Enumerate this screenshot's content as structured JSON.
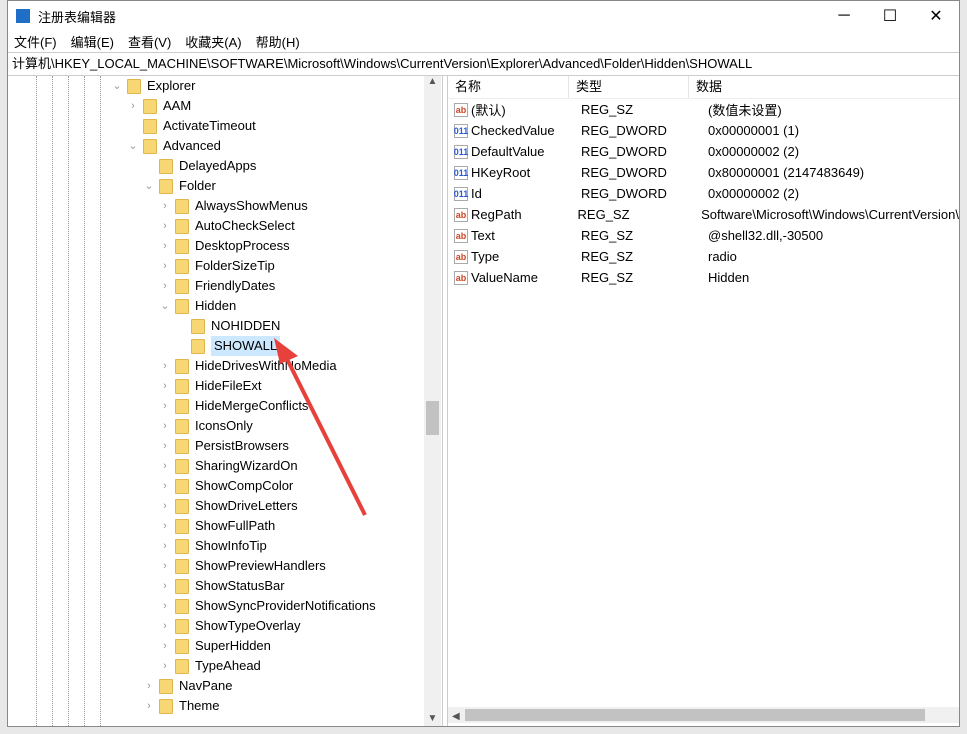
{
  "window": {
    "title": "注册表编辑器",
    "minimize": "─",
    "maximize": "☐",
    "close": "✕"
  },
  "menu": [
    "文件(F)",
    "编辑(E)",
    "查看(V)",
    "收藏夹(A)",
    "帮助(H)"
  ],
  "address": "计算机\\HKEY_LOCAL_MACHINE\\SOFTWARE\\Microsoft\\Windows\\CurrentVersion\\Explorer\\Advanced\\Folder\\Hidden\\SHOWALL",
  "tree": [
    {
      "label": "Explorer",
      "level": 0,
      "state": "expanded"
    },
    {
      "label": "AAM",
      "level": 1,
      "state": "collapsed"
    },
    {
      "label": "ActivateTimeout",
      "level": 1,
      "state": "leaf"
    },
    {
      "label": "Advanced",
      "level": 1,
      "state": "expanded"
    },
    {
      "label": "DelayedApps",
      "level": 2,
      "state": "leaf"
    },
    {
      "label": "Folder",
      "level": 2,
      "state": "expanded"
    },
    {
      "label": "AlwaysShowMenus",
      "level": 3,
      "state": "collapsed"
    },
    {
      "label": "AutoCheckSelect",
      "level": 3,
      "state": "collapsed"
    },
    {
      "label": "DesktopProcess",
      "level": 3,
      "state": "collapsed"
    },
    {
      "label": "FolderSizeTip",
      "level": 3,
      "state": "collapsed"
    },
    {
      "label": "FriendlyDates",
      "level": 3,
      "state": "collapsed"
    },
    {
      "label": "Hidden",
      "level": 3,
      "state": "expanded"
    },
    {
      "label": "NOHIDDEN",
      "level": 4,
      "state": "leaf"
    },
    {
      "label": "SHOWALL",
      "level": 4,
      "state": "leaf",
      "selected": true
    },
    {
      "label": "HideDrivesWithNoMedia",
      "level": 3,
      "state": "collapsed"
    },
    {
      "label": "HideFileExt",
      "level": 3,
      "state": "collapsed"
    },
    {
      "label": "HideMergeConflicts",
      "level": 3,
      "state": "collapsed"
    },
    {
      "label": "IconsOnly",
      "level": 3,
      "state": "collapsed"
    },
    {
      "label": "PersistBrowsers",
      "level": 3,
      "state": "collapsed"
    },
    {
      "label": "SharingWizardOn",
      "level": 3,
      "state": "collapsed"
    },
    {
      "label": "ShowCompColor",
      "level": 3,
      "state": "collapsed"
    },
    {
      "label": "ShowDriveLetters",
      "level": 3,
      "state": "collapsed"
    },
    {
      "label": "ShowFullPath",
      "level": 3,
      "state": "collapsed"
    },
    {
      "label": "ShowInfoTip",
      "level": 3,
      "state": "collapsed"
    },
    {
      "label": "ShowPreviewHandlers",
      "level": 3,
      "state": "collapsed"
    },
    {
      "label": "ShowStatusBar",
      "level": 3,
      "state": "collapsed"
    },
    {
      "label": "ShowSyncProviderNotifications",
      "level": 3,
      "state": "collapsed"
    },
    {
      "label": "ShowTypeOverlay",
      "level": 3,
      "state": "collapsed"
    },
    {
      "label": "SuperHidden",
      "level": 3,
      "state": "collapsed"
    },
    {
      "label": "TypeAhead",
      "level": 3,
      "state": "collapsed"
    },
    {
      "label": "NavPane",
      "level": 2,
      "state": "collapsed"
    },
    {
      "label": "Theme",
      "level": 2,
      "state": "collapsed"
    }
  ],
  "columns": [
    "名称",
    "类型",
    "数据"
  ],
  "values": [
    {
      "icon": "ab",
      "name": "(默认)",
      "type": "REG_SZ",
      "data": "(数值未设置)"
    },
    {
      "icon": "bin",
      "name": "CheckedValue",
      "type": "REG_DWORD",
      "data": "0x00000001 (1)"
    },
    {
      "icon": "bin",
      "name": "DefaultValue",
      "type": "REG_DWORD",
      "data": "0x00000002 (2)"
    },
    {
      "icon": "bin",
      "name": "HKeyRoot",
      "type": "REG_DWORD",
      "data": "0x80000001 (2147483649)"
    },
    {
      "icon": "bin",
      "name": "Id",
      "type": "REG_DWORD",
      "data": "0x00000002 (2)"
    },
    {
      "icon": "ab",
      "name": "RegPath",
      "type": "REG_SZ",
      "data": "Software\\Microsoft\\Windows\\CurrentVersion\\"
    },
    {
      "icon": "ab",
      "name": "Text",
      "type": "REG_SZ",
      "data": "@shell32.dll,-30500"
    },
    {
      "icon": "ab",
      "name": "Type",
      "type": "REG_SZ",
      "data": "radio"
    },
    {
      "icon": "ab",
      "name": "ValueName",
      "type": "REG_SZ",
      "data": "Hidden"
    }
  ],
  "icon_labels": {
    "ab": "ab",
    "bin": "011"
  },
  "colors": {
    "arrow": "#e8403a",
    "selection": "#cce8ff",
    "folder": "#f7d774"
  }
}
